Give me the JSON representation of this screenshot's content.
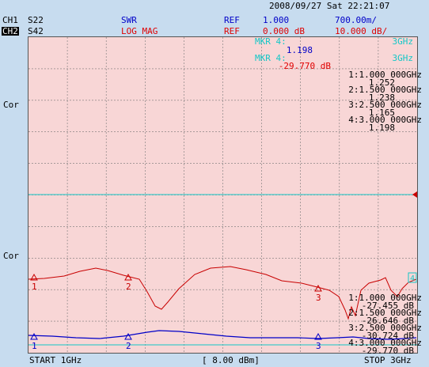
{
  "header": {
    "datetime": "2008/09/27 Sat 22:21:07"
  },
  "ch1": {
    "label": "CH1",
    "param": "S22",
    "format": "SWR",
    "ref_label": "REF",
    "ref_value": "1.000",
    "scale": "700.00m/"
  },
  "ch2": {
    "label": "CH2",
    "param": "S42",
    "format": "LOG MAG",
    "ref_label": "REF",
    "ref_value": "0.000 dB",
    "scale": "10.000 dB/"
  },
  "side_labels": {
    "upper": "Cor",
    "lower": "Cor"
  },
  "active_marker_ch1": {
    "label": "MKR 4:",
    "freq": "3GHz",
    "value": "1.198"
  },
  "active_marker_ch2": {
    "label": "MKR 4:",
    "freq": "3GHz",
    "value": "-29.770 dB"
  },
  "marker_list_ch1": [
    {
      "id": "1:",
      "freq": "1.000 000GHz",
      "value": "1.252"
    },
    {
      "id": "2:",
      "freq": "1.500 000GHz",
      "value": "1.238"
    },
    {
      "id": "3:",
      "freq": "2.500 000GHz",
      "value": "1.165"
    },
    {
      "id": "4:",
      "freq": "3.000 000GHz",
      "value": "1.198"
    }
  ],
  "marker_list_ch2": [
    {
      "id": "1:",
      "freq": "1.000 000GHz",
      "value": "-27.455 dB"
    },
    {
      "id": "2:",
      "freq": "1.500 000GHz",
      "value": "-26.646 dB"
    },
    {
      "id": "3:",
      "freq": "2.500 000GHz",
      "value": "-30.724 dB"
    },
    {
      "id": "4:",
      "freq": "3.000 000GHz",
      "value": "-29.770 dB"
    }
  ],
  "marker_tags": {
    "m1": "1",
    "m2": "2",
    "m3": "3",
    "m4": "4"
  },
  "footer": {
    "start": "START 1GHz",
    "power": "[ 8.00 dBm]",
    "stop": "STOP 3GHz"
  },
  "colors": {
    "ch1_trace": "#0000c8",
    "ch2_trace": "#c80000",
    "ref_line": "#13c7c7",
    "plot_bg": "#f8d6d6",
    "screen_bg": "#c7dcef"
  }
}
